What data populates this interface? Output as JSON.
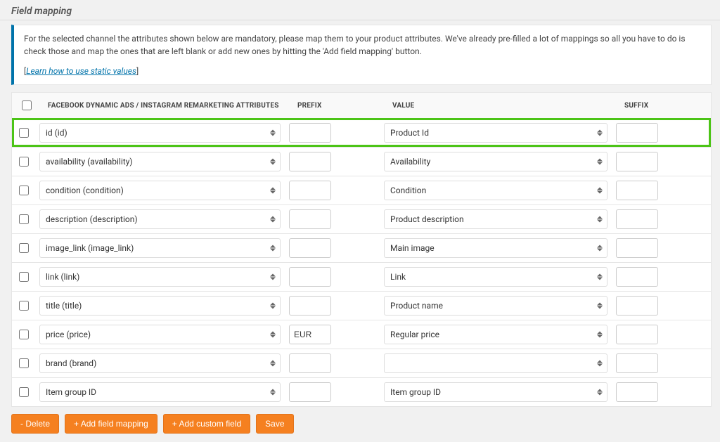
{
  "title": "Field mapping",
  "info": {
    "text": "For the selected channel the attributes shown below are mandatory, please map them to your product attributes. We've already pre-filled a lot of mappings so all you have to do is check those and map the ones that are left blank or add new ones by hitting the 'Add field mapping' button.",
    "link_prefix": "[",
    "link_text": "Learn how to use static values",
    "link_suffix": "]"
  },
  "columns": {
    "attr": "FACEBOOK DYNAMIC ADS / INSTAGRAM REMARKETING ATTRIBUTES",
    "prefix": "PREFIX",
    "value": "VALUE",
    "suffix": "SUFFIX"
  },
  "rows": [
    {
      "highlight": true,
      "attr": "id (id)",
      "prefix": "",
      "value": "Product Id",
      "suffix": ""
    },
    {
      "highlight": false,
      "attr": "availability (availability)",
      "prefix": "",
      "value": "Availability",
      "suffix": ""
    },
    {
      "highlight": false,
      "attr": "condition (condition)",
      "prefix": "",
      "value": "Condition",
      "suffix": ""
    },
    {
      "highlight": false,
      "attr": "description (description)",
      "prefix": "",
      "value": "Product description",
      "suffix": ""
    },
    {
      "highlight": false,
      "attr": "image_link (image_link)",
      "prefix": "",
      "value": "Main image",
      "suffix": ""
    },
    {
      "highlight": false,
      "attr": "link (link)",
      "prefix": "",
      "value": "Link",
      "suffix": ""
    },
    {
      "highlight": false,
      "attr": "title (title)",
      "prefix": "",
      "value": "Product name",
      "suffix": ""
    },
    {
      "highlight": false,
      "attr": "price (price)",
      "prefix": "EUR",
      "value": "Regular price",
      "suffix": ""
    },
    {
      "highlight": false,
      "attr": "brand (brand)",
      "prefix": "",
      "value": "",
      "suffix": ""
    },
    {
      "highlight": false,
      "attr": "Item group ID",
      "prefix": "",
      "value": "Item group ID",
      "suffix": ""
    }
  ],
  "buttons": {
    "delete": "- Delete",
    "add_field": "+ Add field mapping",
    "add_custom": "+ Add custom field",
    "save": "Save"
  }
}
